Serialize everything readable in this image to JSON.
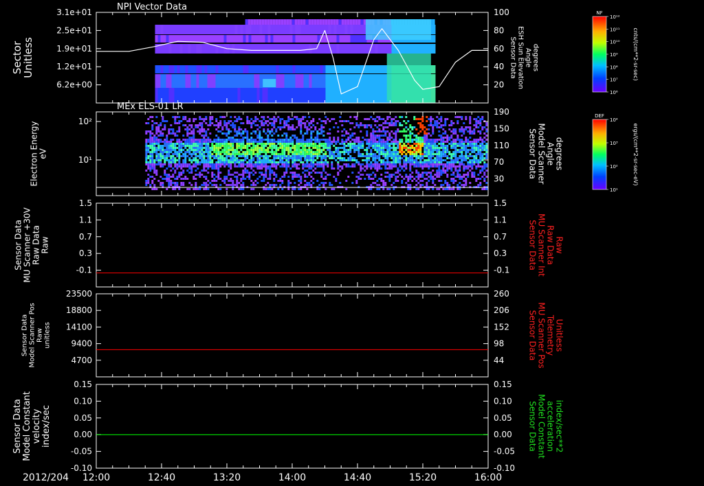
{
  "panels": [
    {
      "title": "NPI Vector Data",
      "ylabel": [
        "Sector",
        "Unitless"
      ],
      "left_ticks": [
        "3.1e+01",
        "2.5e+01",
        "1.9e+01",
        "1.2e+01",
        "6.2e+00"
      ],
      "right_ticks": [
        "100",
        "80",
        "60",
        "40",
        "20"
      ],
      "right_label": [
        "Sensor Data",
        "ESH Sun Elevation",
        "Angle",
        "degrees"
      ],
      "right_label_color": "#ffffff",
      "colorbar": {
        "label": "NF",
        "ticks": [
          "10¹²",
          "10¹¹",
          "10¹⁰",
          "10⁹",
          "10⁸",
          "10⁷",
          "10⁶"
        ],
        "units": "cnts/(cm**2-sr-sec)"
      }
    },
    {
      "title": "MEx ELS-01 LR",
      "ylabel": [
        "Electron Energy",
        "eV"
      ],
      "left_ticks": [
        "10²",
        "10¹"
      ],
      "right_ticks": [
        "190",
        "150",
        "110",
        "70",
        "30"
      ],
      "right_label": [
        "Sensor Data",
        "Model Scanner",
        "Angle",
        "degrees"
      ],
      "right_label_color": "#ffffff",
      "colorbar": {
        "label": "DEF",
        "ticks": [
          "10⁴",
          "10³",
          "10²",
          "10¹"
        ],
        "units": "ergs/(cm**2-sr-sec-eV)"
      }
    },
    {
      "ylabel": [
        "Sensor Data",
        "MU Scanner +30V",
        "Raw Data",
        "Raw"
      ],
      "left_ticks": [
        "1.5",
        "1.1",
        "0.7",
        "0.3",
        "-0.1"
      ],
      "right_ticks": [
        "1.5",
        "1.1",
        "0.7",
        "0.3",
        "-0.1"
      ],
      "right_label": [
        "Sensor Data",
        "MU Scanner Int",
        "Raw Data",
        "Raw"
      ],
      "right_label_color": "#ff2020",
      "line_color": "#ff0000"
    },
    {
      "ylabel": [
        "Sensor Data",
        "Model Scanner Pos",
        "Raw",
        "unitless"
      ],
      "left_ticks": [
        "23500",
        "18800",
        "14100",
        "9400",
        "4700"
      ],
      "right_ticks": [
        "260",
        "206",
        "152",
        "98",
        "44"
      ],
      "right_label": [
        "Sensor Data",
        "MU Scanner Pos",
        "Telemetry",
        "Unitless"
      ],
      "right_label_color": "#ff2020",
      "line_color": "#ff0000"
    },
    {
      "ylabel": [
        "Sensor Data",
        "Model Constant",
        "velocity",
        "index/sec"
      ],
      "left_ticks": [
        "0.15",
        "0.10",
        "0.05",
        "0.00",
        "-0.05",
        "-0.10"
      ],
      "right_ticks": [
        "0.15",
        "0.10",
        "0.05",
        "0.00",
        "-0.05",
        "-0.10"
      ],
      "right_label": [
        "Sensor Data",
        "Model Constant",
        "acceleration",
        "index/sec**2"
      ],
      "right_label_color": "#20e020",
      "line_color": "#00ff00"
    }
  ],
  "xaxis": {
    "date": "2012/204",
    "ticks": [
      "12:00",
      "12:40",
      "13:20",
      "14:00",
      "14:40",
      "15:20",
      "16:00"
    ]
  },
  "chart_data": [
    {
      "type": "heatmap",
      "title": "NPI Vector Data",
      "xlabel": "",
      "ylabel": "Sector Unitless",
      "x_range": [
        "12:00",
        "16:00"
      ],
      "overlay_series": {
        "name": "Sensor Data ESH Sun Elevation Angle degrees",
        "x_minutes": [
          0,
          20,
          35,
          50,
          65,
          80,
          95,
          110,
          125,
          135,
          140,
          145,
          150,
          160,
          170,
          175,
          185,
          195,
          200,
          210,
          220,
          230,
          240
        ],
        "y": [
          57,
          57,
          62,
          68,
          67,
          60,
          58,
          58,
          58,
          60,
          80,
          50,
          10,
          18,
          70,
          82,
          58,
          25,
          15,
          18,
          45,
          58,
          58
        ]
      },
      "data_window_minutes": [
        50,
        210
      ]
    },
    {
      "type": "heatmap",
      "title": "MEx ELS-01 LR",
      "ylabel": "Electron Energy eV",
      "x_range": [
        "12:00",
        "16:00"
      ],
      "data_window_minutes": [
        30,
        240
      ]
    },
    {
      "type": "line",
      "ylim": [
        -0.3,
        1.5
      ],
      "series": [
        {
          "name": "Sensor Data MU Scanner +30V Raw Data Raw",
          "x_minutes": [
            0,
            240
          ],
          "y": [
            0.0,
            0.0
          ]
        }
      ]
    },
    {
      "type": "line",
      "ylim": [
        0,
        23500
      ],
      "series": [
        {
          "name": "Sensor Data Model Scanner Pos Raw unitless",
          "x_minutes": [
            0,
            240
          ],
          "y": [
            7700,
            7700
          ]
        }
      ]
    },
    {
      "type": "line",
      "ylim": [
        -0.1,
        0.15
      ],
      "series": [
        {
          "name": "Sensor Data Model Constant velocity index/sec",
          "x_minutes": [
            0,
            240
          ],
          "y": [
            0.0,
            0.0
          ]
        }
      ]
    }
  ]
}
